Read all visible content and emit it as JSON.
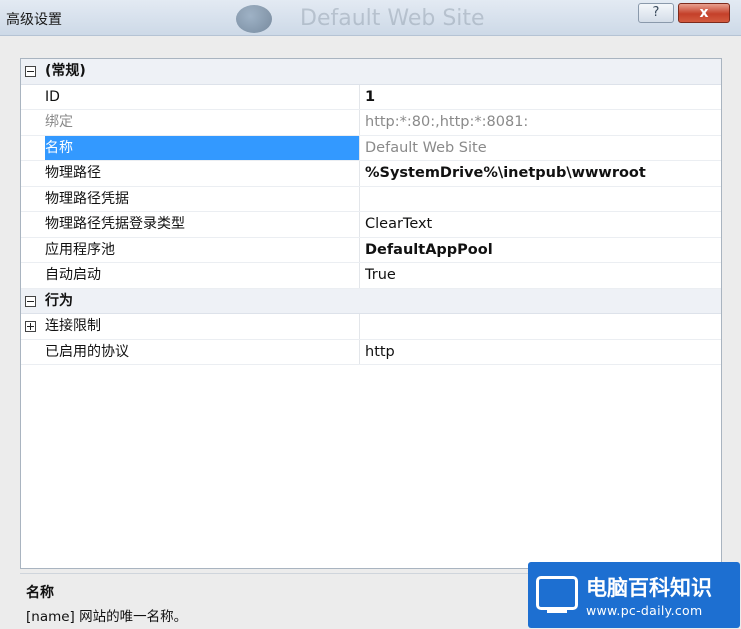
{
  "window": {
    "title": "高级设置",
    "background_title": "Default Web Site",
    "help_button": "?",
    "close_button": "x"
  },
  "grid": {
    "rows": [
      {
        "kind": "category",
        "toggle": "minus",
        "name": "(常规)",
        "value": ""
      },
      {
        "kind": "property",
        "name": "ID",
        "value": "1",
        "bold": true
      },
      {
        "kind": "property",
        "name": "绑定",
        "value": "http:*:80:,http:*:8081:",
        "dim": true
      },
      {
        "kind": "property",
        "name": "名称",
        "value": "Default Web Site",
        "selected": true,
        "dim": true
      },
      {
        "kind": "property",
        "name": "物理路径",
        "value": "%SystemDrive%\\inetpub\\wwwroot",
        "bold": true
      },
      {
        "kind": "property",
        "name": "物理路径凭据",
        "value": ""
      },
      {
        "kind": "property",
        "name": "物理路径凭据登录类型",
        "value": "ClearText"
      },
      {
        "kind": "property",
        "name": "应用程序池",
        "value": "DefaultAppPool",
        "bold": true
      },
      {
        "kind": "property",
        "name": "自动启动",
        "value": "True"
      },
      {
        "kind": "category",
        "toggle": "minus",
        "name": "行为",
        "value": ""
      },
      {
        "kind": "expandable",
        "toggle": "plus",
        "name": "连接限制",
        "value": ""
      },
      {
        "kind": "property",
        "name": "已启用的协议",
        "value": "http"
      }
    ]
  },
  "description": {
    "title": "名称",
    "text": "[name] 网站的唯一名称。"
  },
  "watermark": {
    "title": "电脑百科知识",
    "url": "www.pc-daily.com"
  },
  "colors": {
    "selection": "#3399ff",
    "category_bg": "#eef1f6",
    "close_button": "#c4402a",
    "watermark_bg": "#1d6fd1"
  }
}
